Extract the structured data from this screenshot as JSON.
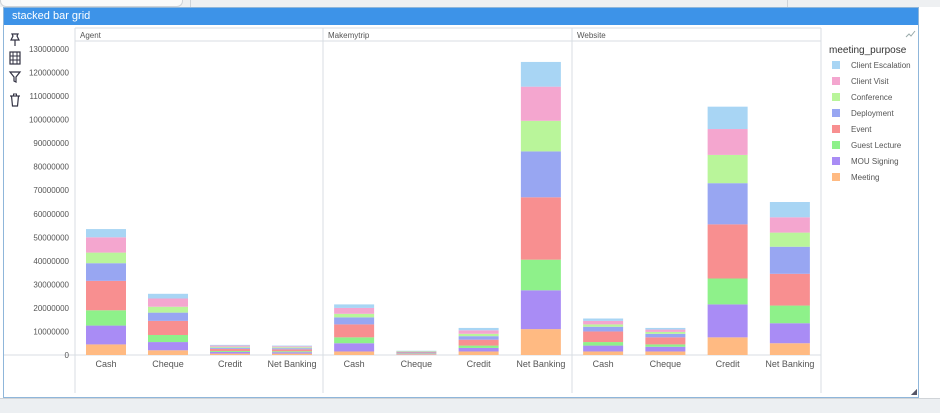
{
  "window": {
    "title": "stacked bar grid"
  },
  "toolbar": {
    "tools": [
      "pin-icon",
      "grid-icon",
      "filter-icon",
      "trash-icon"
    ]
  },
  "expand_icon": "trend-line-icon",
  "colors": {
    "title_bar": "#3d93e8",
    "panel_border": "#d8dde3"
  },
  "chart_data": {
    "type": "bar",
    "stacked": true,
    "facets": [
      "Agent",
      "Makemytrip",
      "Website"
    ],
    "categories": [
      "Cash",
      "Cheque",
      "Credit",
      "Net Banking"
    ],
    "ylim": [
      0,
      130000000
    ],
    "yticks": [
      0,
      10000000,
      20000000,
      30000000,
      40000000,
      50000000,
      60000000,
      70000000,
      80000000,
      90000000,
      100000000,
      110000000,
      120000000,
      130000000
    ],
    "grid": false,
    "legend": {
      "title": "meeting_purpose",
      "placement": "right"
    },
    "series": [
      {
        "name": "Meeting",
        "color": "#ffba82",
        "values": [
          [
            4500000,
            2000000,
            600000,
            600000
          ],
          [
            1500000,
            300000,
            1500000,
            11000000
          ],
          [
            1500000,
            1500000,
            7500000,
            5000000
          ]
        ]
      },
      {
        "name": "MOU Signing",
        "color": "#a98cf5",
        "values": [
          [
            8000000,
            3500000,
            700000,
            600000
          ],
          [
            3500000,
            300000,
            1500000,
            16500000
          ],
          [
            2500000,
            2000000,
            14000000,
            8500000
          ]
        ]
      },
      {
        "name": "Guest Lecture",
        "color": "#8ef18a",
        "values": [
          [
            6500000,
            3000000,
            400000,
            400000
          ],
          [
            2500000,
            200000,
            1000000,
            13000000
          ],
          [
            1500000,
            1000000,
            11000000,
            7500000
          ]
        ]
      },
      {
        "name": "Event",
        "color": "#f88f90",
        "values": [
          [
            12500000,
            6000000,
            900000,
            800000
          ],
          [
            5500000,
            300000,
            2500000,
            26500000
          ],
          [
            4500000,
            3000000,
            23000000,
            13500000
          ]
        ]
      },
      {
        "name": "Deployment",
        "color": "#98a6f2",
        "values": [
          [
            7500000,
            3500000,
            500000,
            500000
          ],
          [
            3000000,
            200000,
            1500000,
            19500000
          ],
          [
            2000000,
            1500000,
            17500000,
            11500000
          ]
        ]
      },
      {
        "name": "Conference",
        "color": "#b9f59a",
        "values": [
          [
            4500000,
            2500000,
            400000,
            400000
          ],
          [
            1500000,
            200000,
            1000000,
            13000000
          ],
          [
            1000000,
            800000,
            12000000,
            6000000
          ]
        ]
      },
      {
        "name": "Client Visit",
        "color": "#f4a6cf",
        "values": [
          [
            6500000,
            3500000,
            500000,
            400000
          ],
          [
            2500000,
            200000,
            1500000,
            14500000
          ],
          [
            1500000,
            1000000,
            11000000,
            6500000
          ]
        ]
      },
      {
        "name": "Client Escalation",
        "color": "#a8d5f4",
        "values": [
          [
            3500000,
            2000000,
            300000,
            300000
          ],
          [
            1500000,
            100000,
            1000000,
            10500000
          ],
          [
            1000000,
            700000,
            9500000,
            6500000
          ]
        ]
      }
    ]
  }
}
